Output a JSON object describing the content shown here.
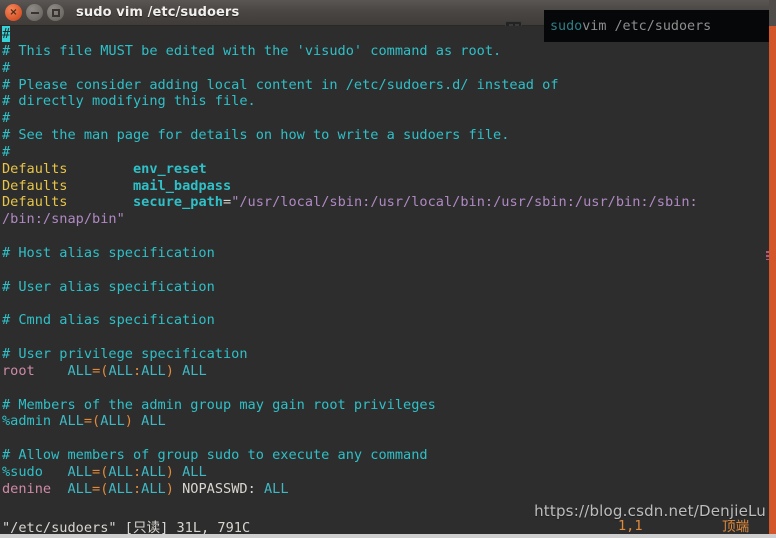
{
  "window": {
    "title": "sudo vim /etc/sudoers",
    "controls": [
      {
        "name": "close",
        "glyph": "×"
      },
      {
        "name": "minimize",
        "glyph": ""
      },
      {
        "name": "maximize",
        "glyph": ""
      }
    ]
  },
  "overlay": {
    "part1": "sudo",
    "part2": " vim /etc/sudoers"
  },
  "editor": {
    "lines": [
      {
        "segments": [
          {
            "t": "#",
            "c": "cursor"
          }
        ]
      },
      {
        "segments": [
          {
            "t": "# This file MUST be edited with the 'visudo' command as root.",
            "c": "cmt"
          }
        ]
      },
      {
        "segments": [
          {
            "t": "#",
            "c": "cmt"
          }
        ]
      },
      {
        "segments": [
          {
            "t": "# Please consider adding local content in /etc/sudoers.d/ instead of",
            "c": "cmt"
          }
        ]
      },
      {
        "segments": [
          {
            "t": "# directly modifying this file.",
            "c": "cmt"
          }
        ]
      },
      {
        "segments": [
          {
            "t": "#",
            "c": "cmt"
          }
        ]
      },
      {
        "segments": [
          {
            "t": "# See the man page for details on how to write a sudoers file.",
            "c": "cmt"
          }
        ]
      },
      {
        "segments": [
          {
            "t": "#",
            "c": "cmt"
          }
        ]
      },
      {
        "segments": [
          {
            "t": "Defaults",
            "c": "kw"
          },
          {
            "t": "        ",
            "c": "plain"
          },
          {
            "t": "env_reset",
            "c": "opt"
          }
        ]
      },
      {
        "segments": [
          {
            "t": "Defaults",
            "c": "kw"
          },
          {
            "t": "        ",
            "c": "plain"
          },
          {
            "t": "mail_badpass",
            "c": "opt"
          }
        ]
      },
      {
        "segments": [
          {
            "t": "Defaults",
            "c": "kw"
          },
          {
            "t": "        ",
            "c": "plain"
          },
          {
            "t": "secure_path",
            "c": "opt"
          },
          {
            "t": "=",
            "c": "plain"
          },
          {
            "t": "\"/usr/local/sbin:/usr/local/bin:/usr/sbin:/usr/bin:/sbin:",
            "c": "str"
          }
        ]
      },
      {
        "segments": [
          {
            "t": "/bin:/snap/bin\"",
            "c": "str"
          }
        ]
      },
      {
        "segments": [
          {
            "t": "",
            "c": "plain"
          }
        ]
      },
      {
        "segments": [
          {
            "t": "# Host alias specification",
            "c": "cmt"
          }
        ]
      },
      {
        "segments": [
          {
            "t": "",
            "c": "plain"
          }
        ]
      },
      {
        "segments": [
          {
            "t": "# User alias specification",
            "c": "cmt"
          }
        ]
      },
      {
        "segments": [
          {
            "t": "",
            "c": "plain"
          }
        ]
      },
      {
        "segments": [
          {
            "t": "# Cmnd alias specification",
            "c": "cmt"
          }
        ]
      },
      {
        "segments": [
          {
            "t": "",
            "c": "plain"
          }
        ]
      },
      {
        "segments": [
          {
            "t": "# User privilege specification",
            "c": "cmt"
          }
        ]
      },
      {
        "segments": [
          {
            "t": "root",
            "c": "user"
          },
          {
            "t": "    ",
            "c": "plain"
          },
          {
            "t": "ALL",
            "c": "all"
          },
          {
            "t": "=(",
            "c": "op"
          },
          {
            "t": "ALL",
            "c": "all"
          },
          {
            "t": ":",
            "c": "op"
          },
          {
            "t": "ALL",
            "c": "all"
          },
          {
            "t": ")",
            "c": "op"
          },
          {
            "t": " ",
            "c": "plain"
          },
          {
            "t": "ALL",
            "c": "all"
          }
        ]
      },
      {
        "segments": [
          {
            "t": "",
            "c": "plain"
          }
        ]
      },
      {
        "segments": [
          {
            "t": "# Members of the admin group may gain root privileges",
            "c": "cmt"
          }
        ]
      },
      {
        "segments": [
          {
            "t": "%admin",
            "c": "grp"
          },
          {
            "t": " ",
            "c": "plain"
          },
          {
            "t": "ALL",
            "c": "all"
          },
          {
            "t": "=(",
            "c": "op"
          },
          {
            "t": "ALL",
            "c": "all"
          },
          {
            "t": ")",
            "c": "op"
          },
          {
            "t": " ",
            "c": "plain"
          },
          {
            "t": "ALL",
            "c": "all"
          }
        ]
      },
      {
        "segments": [
          {
            "t": "",
            "c": "plain"
          }
        ]
      },
      {
        "segments": [
          {
            "t": "# Allow members of group sudo to execute any command",
            "c": "cmt"
          }
        ]
      },
      {
        "segments": [
          {
            "t": "%sudo",
            "c": "grp"
          },
          {
            "t": "   ",
            "c": "plain"
          },
          {
            "t": "ALL",
            "c": "all"
          },
          {
            "t": "=(",
            "c": "op"
          },
          {
            "t": "ALL",
            "c": "all"
          },
          {
            "t": ":",
            "c": "op"
          },
          {
            "t": "ALL",
            "c": "all"
          },
          {
            "t": ")",
            "c": "op"
          },
          {
            "t": " ",
            "c": "plain"
          },
          {
            "t": "ALL",
            "c": "all"
          }
        ]
      },
      {
        "segments": [
          {
            "t": "denine",
            "c": "user"
          },
          {
            "t": "  ",
            "c": "plain"
          },
          {
            "t": "ALL",
            "c": "all"
          },
          {
            "t": "=(",
            "c": "op"
          },
          {
            "t": "ALL",
            "c": "all"
          },
          {
            "t": ":",
            "c": "op"
          },
          {
            "t": "ALL",
            "c": "all"
          },
          {
            "t": ")",
            "c": "op"
          },
          {
            "t": " ",
            "c": "plain"
          },
          {
            "t": "NOPASSWD:",
            "c": "plain"
          },
          {
            "t": " ",
            "c": "plain"
          },
          {
            "t": "ALL",
            "c": "all"
          }
        ]
      }
    ]
  },
  "status": {
    "file_info": "\"/etc/sudoers\" [只读] 31L, 791C",
    "position": "1,1",
    "scroll": "顶端"
  },
  "watermark": {
    "text": "https://blog.csdn.net/DenjieLu"
  },
  "colors": {
    "background": "#2d2d2d",
    "titlebar": "#4a4643",
    "comment": "#2fc0c8",
    "keyword": "#e8c547",
    "string": "#b089c4",
    "user": "#cf8aa8",
    "operator": "#e08a3c",
    "accent_stripe": "#d2562a",
    "close_button": "#d8542a"
  }
}
